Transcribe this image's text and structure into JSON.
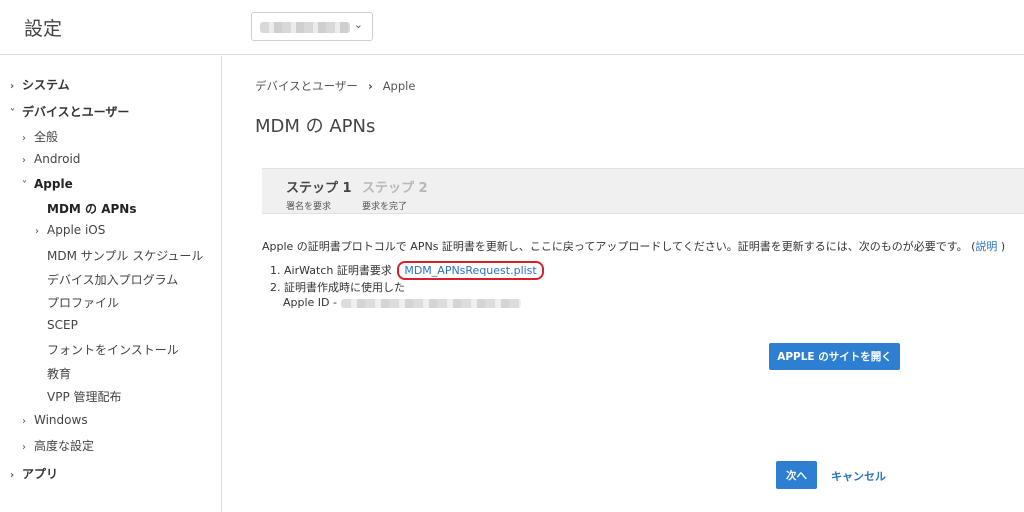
{
  "header": {
    "title": "設定",
    "org_selector": {
      "chevron": "⌄"
    }
  },
  "sidebar": {
    "items": [
      {
        "label": "システム",
        "arrow": "›"
      },
      {
        "label": "デバイスとユーザー",
        "arrow": "˅"
      },
      {
        "label": "全般",
        "arrow": "›"
      },
      {
        "label": "Android",
        "arrow": "›"
      },
      {
        "label": "Apple",
        "arrow": "˅"
      },
      {
        "label": "MDM の APNs",
        "arrow": ""
      },
      {
        "label": "Apple iOS",
        "arrow": "›"
      },
      {
        "label": "MDM サンプル スケジュール",
        "arrow": ""
      },
      {
        "label": "デバイス加入プログラム",
        "arrow": ""
      },
      {
        "label": "プロファイル",
        "arrow": ""
      },
      {
        "label": "SCEP",
        "arrow": ""
      },
      {
        "label": "フォントをインストール",
        "arrow": ""
      },
      {
        "label": "教育",
        "arrow": ""
      },
      {
        "label": "VPP 管理配布",
        "arrow": ""
      },
      {
        "label": "Windows",
        "arrow": "›"
      },
      {
        "label": "高度な設定",
        "arrow": "›"
      },
      {
        "label": "アプリ",
        "arrow": "›"
      }
    ]
  },
  "breadcrumb": {
    "parent": "デバイスとユーザー",
    "separator": "›",
    "current": "Apple"
  },
  "page_title": "MDM の APNs",
  "steps": [
    {
      "name": "ステップ 1",
      "sub": "署名を要求"
    },
    {
      "name": "ステップ 2",
      "sub": "要求を完了"
    }
  ],
  "intro": {
    "text": "Apple の証明書プロトコルで APNs 証明書を更新し、ここに戻ってアップロードしてください。証明書を更新するには、次のものが必要です。 (",
    "link": "説明",
    "close": " )"
  },
  "requirements": {
    "item1_label": "1. AirWatch 証明書要求",
    "item1_link": "MDM_APNsRequest.plist",
    "item2_label": "2. 証明書作成時に使用した",
    "item2_sub": "Apple ID -"
  },
  "buttons": {
    "apple_site": "APPLE のサイトを開く",
    "next": "次へ",
    "cancel": "キャンセル"
  },
  "colors": {
    "accent": "#2e7fd1",
    "link": "#2b72c2",
    "highlight_ring": "#d8202a"
  }
}
